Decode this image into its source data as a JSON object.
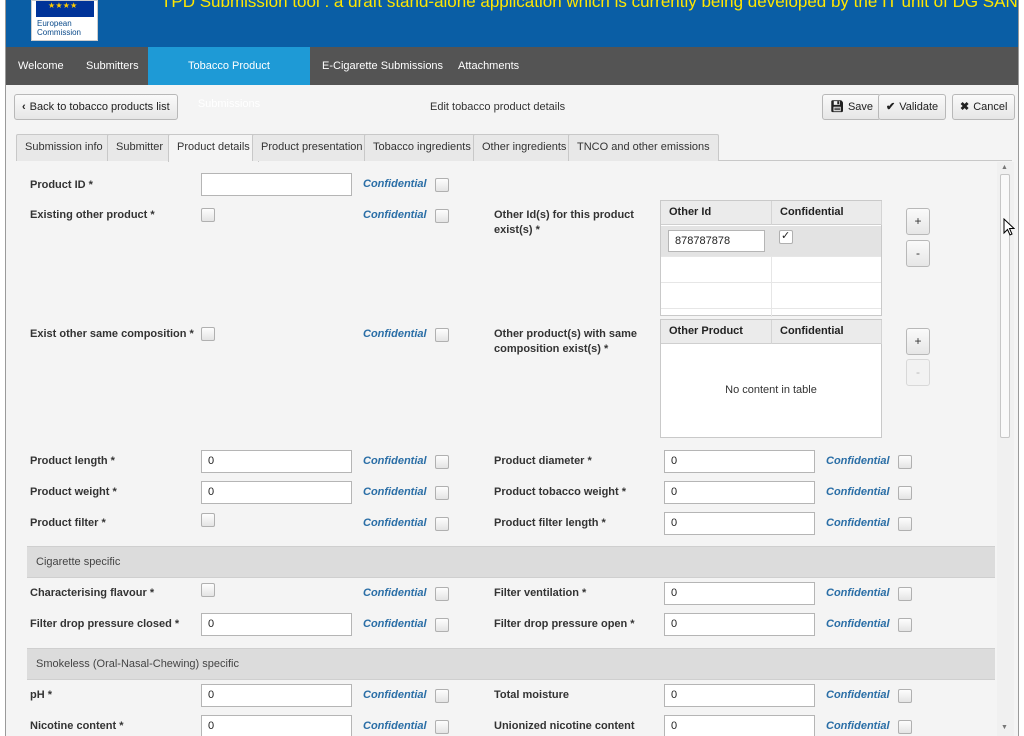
{
  "banner": {
    "title": "TPD Submission tool : a draft stand-alone application which is currently being developed by the IT unit of DG SANTE",
    "logo_text": "European Commission",
    "colors": {
      "blue": "#0a5ea5",
      "title": "#ffe600"
    }
  },
  "nav": {
    "items": [
      {
        "label": "Welcome"
      },
      {
        "label": "Submitters"
      },
      {
        "label": "Tobacco Product Submissions",
        "active": true
      },
      {
        "label": "E-Cigarette Submissions"
      },
      {
        "label": "Attachments"
      }
    ],
    "active_color": "#1e9ad6"
  },
  "toolbar": {
    "back_label": "Back to tobacco products list",
    "title": "Edit tobacco product details",
    "save_label": "Save",
    "validate_label": "Validate",
    "cancel_label": "Cancel"
  },
  "tabs": [
    {
      "label": "Submission info"
    },
    {
      "label": "Submitter"
    },
    {
      "label": "Product details",
      "active": true
    },
    {
      "label": "Product presentation"
    },
    {
      "label": "Tobacco ingredients"
    },
    {
      "label": "Other ingredients"
    },
    {
      "label": "TNCO and other emissions"
    }
  ],
  "form": {
    "confidential_label": "Confidential",
    "product_id": {
      "label": "Product ID *",
      "value": ""
    },
    "existing_other_product": {
      "label": "Existing other product *",
      "checked": false
    },
    "other_ids": {
      "label": "Other Id(s) for this product exist(s) *",
      "columns": [
        "Other Id",
        "Confidential"
      ],
      "rows": [
        {
          "other_id": "878787878",
          "confidential": true
        }
      ]
    },
    "exist_other_same_composition": {
      "label": "Exist other same composition *",
      "checked": false
    },
    "other_products_same_composition": {
      "label": "Other product(s) with same composition exist(s) *",
      "columns": [
        "Other Product",
        "Confidential"
      ],
      "empty_text": "No content in table"
    },
    "product_length": {
      "label": "Product length *",
      "value": "0"
    },
    "product_diameter": {
      "label": "Product diameter *",
      "value": "0"
    },
    "product_weight": {
      "label": "Product weight *",
      "value": "0"
    },
    "product_tobacco_weight": {
      "label": "Product tobacco weight *",
      "value": "0"
    },
    "product_filter": {
      "label": "Product filter *",
      "checked": false
    },
    "product_filter_length": {
      "label": "Product filter length *",
      "value": "0"
    },
    "cigarette_section": "Cigarette specific",
    "characterising_flavour": {
      "label": "Characterising flavour *",
      "checked": false
    },
    "filter_ventilation": {
      "label": "Filter ventilation *",
      "value": "0"
    },
    "filter_drop_pressure_closed": {
      "label": "Filter drop pressure closed *",
      "value": "0"
    },
    "filter_drop_pressure_open": {
      "label": "Filter drop pressure open *",
      "value": "0"
    },
    "smokeless_section": "Smokeless (Oral-Nasal-Chewing) specific",
    "ph": {
      "label": "pH *",
      "value": "0"
    },
    "total_moisture": {
      "label": "Total moisture",
      "value": "0"
    },
    "nicotine_content": {
      "label": "Nicotine content *",
      "value": "0"
    },
    "unionized_nicotine_content": {
      "label": "Unionized nicotine content",
      "value": "0"
    }
  },
  "buttons": {
    "plus": "+",
    "minus": "-"
  }
}
